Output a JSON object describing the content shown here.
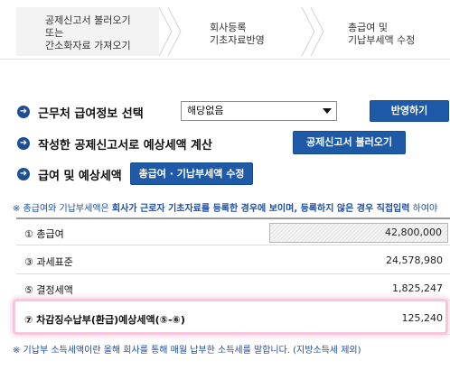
{
  "steps": [
    {
      "line1": "공제신고서 불러오기",
      "line2": "또는",
      "line3": "간소화자료 가져오기"
    },
    {
      "line1": "회사등록",
      "line2": "기초자료반영"
    },
    {
      "line1": "총급여 및",
      "line2": "기납부세액 수정"
    }
  ],
  "section1": {
    "title": "근무처 급여정보 선택",
    "select_value": "해당없음",
    "button": "반영하기"
  },
  "section2": {
    "title": "작성한 공제신고서로 예상세액 계산",
    "button": "공제신고서 불러오기"
  },
  "section3": {
    "title": "급여 및 예상세액",
    "button": "총급여 · 기납부세액 수정"
  },
  "note_top": {
    "prefix": "※ 총급여와 기납부세액은 ",
    "bold": "회사가 근로자 기초자료를 등록한 경우에 보이며, 등록하지 않은 경우 직접입력",
    "suffix": " 하여야"
  },
  "table": [
    {
      "label": "① 총급여",
      "value": "42,800,000"
    },
    {
      "label": "③ 과세표준",
      "value": "24,578,980"
    },
    {
      "label": "⑤ 결정세액",
      "value": "1,825,247"
    },
    {
      "label": "⑦ 차감징수납부(환급)예상세액(⑤-⑥)",
      "value": "125,240"
    }
  ],
  "note_bottom": "※ 기납부 소득세액이란 올해 회사를 통해 매월 납부한 소득세를 말합니다. (지방소득세 제외)"
}
